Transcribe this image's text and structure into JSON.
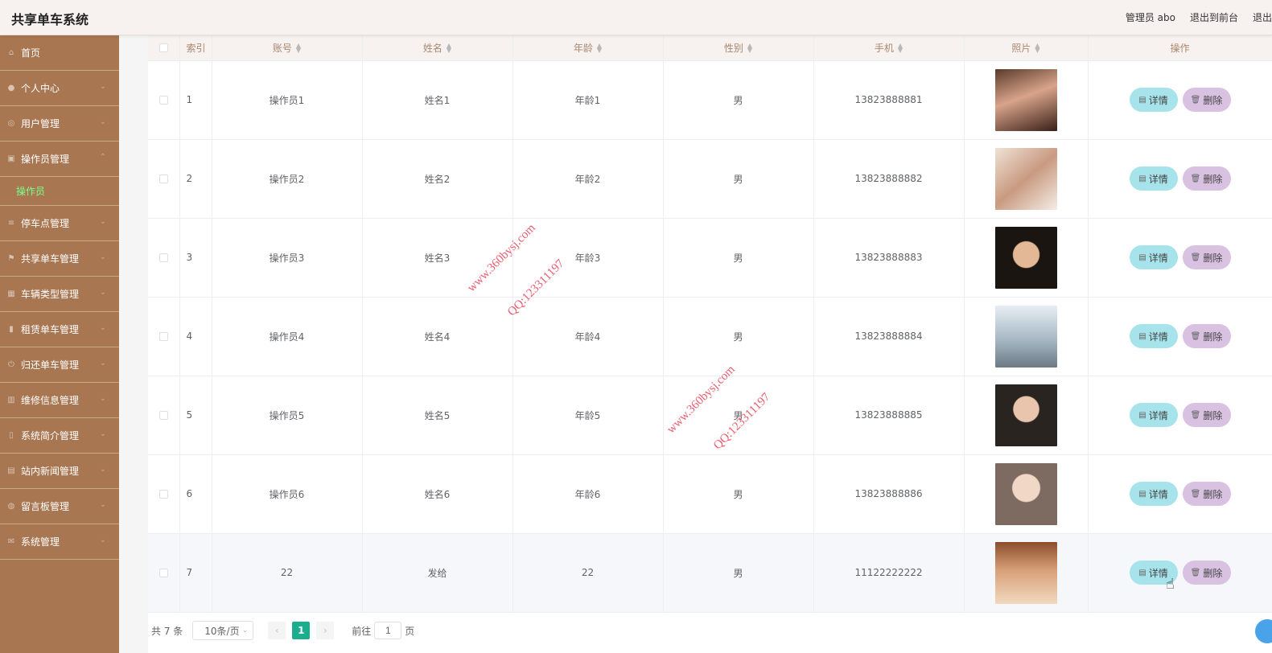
{
  "app_title": "共享单车系统",
  "header": {
    "admin": "管理员 abo",
    "exit_front": "退出到前台",
    "logout": "退出"
  },
  "sidebar": {
    "items": [
      {
        "label": "首页",
        "icon": "home-icon"
      },
      {
        "label": "个人中心",
        "icon": "user-icon"
      },
      {
        "label": "用户管理",
        "icon": "user-manage-icon"
      },
      {
        "label": "操作员管理",
        "icon": "operator-icon"
      },
      {
        "label": "停车点管理",
        "icon": "parking-icon"
      },
      {
        "label": "共享单车管理",
        "icon": "flag-icon"
      },
      {
        "label": "车辆类型管理",
        "icon": "grid-icon"
      },
      {
        "label": "租赁单车管理",
        "icon": "bar-chart-icon"
      },
      {
        "label": "归还单车管理",
        "icon": "power-icon"
      },
      {
        "label": "维修信息管理",
        "icon": "stats-icon"
      },
      {
        "label": "系统简介管理",
        "icon": "phone-icon"
      },
      {
        "label": "站内新闻管理",
        "icon": "news-icon"
      },
      {
        "label": "留言板管理",
        "icon": "message-icon"
      },
      {
        "label": "系统管理",
        "icon": "mail-icon"
      }
    ],
    "active_sub": "操作员"
  },
  "table": {
    "headers": {
      "index": "索引",
      "account": "账号",
      "name": "姓名",
      "age": "年龄",
      "gender": "性别",
      "phone": "手机",
      "photo": "照片",
      "actions": "操作"
    },
    "detail_label": "详情",
    "delete_label": "删除",
    "rows": [
      {
        "index": "1",
        "account": "操作员1",
        "name": "姓名1",
        "age": "年龄1",
        "gender": "男",
        "phone": "13823888881"
      },
      {
        "index": "2",
        "account": "操作员2",
        "name": "姓名2",
        "age": "年龄2",
        "gender": "男",
        "phone": "13823888882"
      },
      {
        "index": "3",
        "account": "操作员3",
        "name": "姓名3",
        "age": "年龄3",
        "gender": "男",
        "phone": "13823888883"
      },
      {
        "index": "4",
        "account": "操作员4",
        "name": "姓名4",
        "age": "年龄4",
        "gender": "男",
        "phone": "13823888884"
      },
      {
        "index": "5",
        "account": "操作员5",
        "name": "姓名5",
        "age": "年龄5",
        "gender": "男",
        "phone": "13823888885"
      },
      {
        "index": "6",
        "account": "操作员6",
        "name": "姓名6",
        "age": "年龄6",
        "gender": "男",
        "phone": "13823888886"
      },
      {
        "index": "7",
        "account": "22",
        "name": "发给",
        "age": "22",
        "gender": "男",
        "phone": "11122222222"
      }
    ]
  },
  "pagination": {
    "total": "共 7 条",
    "page_size": "10条/页",
    "current_page": "1",
    "goto_prefix": "前往",
    "goto_value": "1",
    "goto_suffix": "页"
  },
  "watermarks": {
    "site": "www.360bysj.com",
    "qq": "QQ:123311197"
  },
  "colors": {
    "sidebar_bg": "#a87651",
    "accent_green": "#1aad8e",
    "detail_btn": "#a6e3ea",
    "delete_btn": "#d9c1e2",
    "watermark": "#e8344a"
  }
}
